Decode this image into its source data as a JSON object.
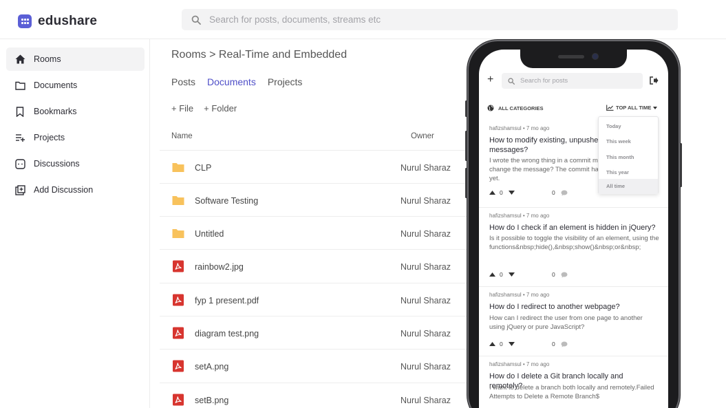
{
  "app": {
    "name": "edushare",
    "brand_color": "#5b5fd6"
  },
  "search": {
    "placeholder": "Search for posts, documents, streams etc"
  },
  "sidebar": {
    "items": [
      {
        "label": "Rooms",
        "icon": "home-icon",
        "active": true
      },
      {
        "label": "Documents",
        "icon": "folder-icon"
      },
      {
        "label": "Bookmarks",
        "icon": "bookmark-icon"
      },
      {
        "label": "Projects",
        "icon": "playlist-add-icon"
      },
      {
        "label": "Discussions",
        "icon": "chat-icon"
      },
      {
        "label": "Add Discussion",
        "icon": "add-square-icon"
      }
    ]
  },
  "breadcrumb": "Rooms > Real-Time and Embedded",
  "tabs": [
    {
      "label": "Posts"
    },
    {
      "label": "Documents",
      "active": true
    },
    {
      "label": "Projects"
    }
  ],
  "actions": {
    "file": "+ File",
    "folder": "+ Folder"
  },
  "table": {
    "columns": {
      "name": "Name",
      "owner": "Owner"
    },
    "rows": [
      {
        "name": "CLP",
        "owner": "Nurul Sharaz",
        "type": "folder"
      },
      {
        "name": "Software Testing",
        "owner": "Nurul Sharaz",
        "type": "folder"
      },
      {
        "name": "Untitled",
        "owner": "Nurul Sharaz",
        "type": "folder"
      },
      {
        "name": "rainbow2.jpg",
        "owner": "Nurul Sharaz",
        "type": "pdf"
      },
      {
        "name": "fyp 1 present.pdf",
        "owner": "Nurul Sharaz",
        "type": "pdf"
      },
      {
        "name": "diagram test.png",
        "owner": "Nurul Sharaz",
        "type": "pdf"
      },
      {
        "name": "setA.png",
        "owner": "Nurul Sharaz",
        "type": "pdf"
      },
      {
        "name": "setB.png",
        "owner": "Nurul Sharaz",
        "type": "pdf"
      }
    ]
  },
  "phone": {
    "search_placeholder": "Search for posts",
    "plus": "+",
    "categories": "ALL CATEGORIES",
    "sort": "TOP ALL TIME",
    "sort_options": [
      "Today",
      "This week",
      "This month",
      "This year",
      "All time"
    ],
    "sort_selected": "All time",
    "posts": [
      {
        "meta": "hafizshamsul • 7 mo ago",
        "title": "How to modify existing, unpushed commit messages?",
        "body": "I wrote the wrong thing in a commit message. How can I change the message? The commit has not been pushed yet.",
        "votes": "0",
        "comments": "0"
      },
      {
        "meta": "hafizshamsul • 7 mo ago",
        "title": "How do I check if an element is hidden in jQuery?",
        "body": "Is it possible to toggle the visibility of an element, using the functions&nbsp;hide(),&nbsp;show()&nbsp;or&nbsp;",
        "votes": "0",
        "comments": "0"
      },
      {
        "meta": "hafizshamsul • 7 mo ago",
        "title": "How do I redirect to another webpage?",
        "body": "How can I redirect the user from one page to another using jQuery or pure JavaScript?",
        "votes": "0",
        "comments": "0"
      },
      {
        "meta": "hafizshamsul • 7 mo ago",
        "title": "How do I delete a Git branch locally and remotely?",
        "body": "I want to delete a branch both locally and remotely.Failed Attempts to Delete a Remote Branch$",
        "votes": "0",
        "comments": "0"
      }
    ]
  }
}
